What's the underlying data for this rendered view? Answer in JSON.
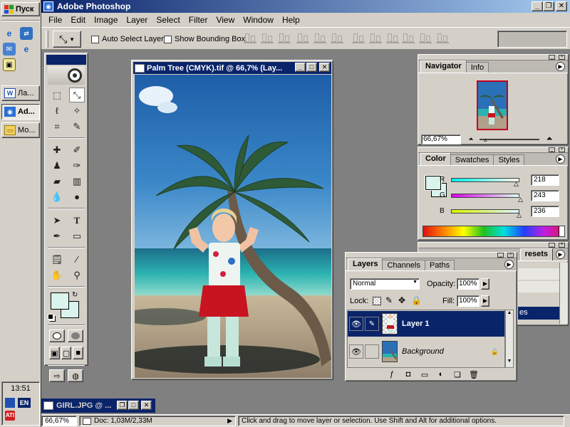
{
  "taskbar": {
    "start_label": "Пуск",
    "clock": "13:51",
    "language": "EN",
    "tasks": [
      {
        "label": "Ла...",
        "icon": "word-icon",
        "active": false
      },
      {
        "label": "Ad...",
        "icon": "photoshop-icon",
        "active": true
      },
      {
        "label": "Мо...",
        "icon": "folder-icon",
        "active": false
      }
    ]
  },
  "app": {
    "title": "Adobe Photoshop",
    "menu": [
      "File",
      "Edit",
      "Image",
      "Layer",
      "Select",
      "Filter",
      "View",
      "Window",
      "Help"
    ]
  },
  "options": {
    "auto_select_label": "Auto Select Layer",
    "bounding_box_label": "Show Bounding Box"
  },
  "document": {
    "title": "Palm Tree (CMYK).tif @ 66,7% (Lay..."
  },
  "navigator": {
    "tabs": [
      "Navigator",
      "Info"
    ],
    "zoom": "66,67%"
  },
  "color": {
    "tabs": [
      "Color",
      "Swatches",
      "Styles"
    ],
    "channels": [
      {
        "label": "R",
        "value": "218"
      },
      {
        "label": "G",
        "value": "243"
      },
      {
        "label": "B",
        "value": "236"
      }
    ],
    "swatch_color": "#daf3ec"
  },
  "presets_behind": {
    "tab_fragment": "resets",
    "row_fragment": "es"
  },
  "layers": {
    "tabs": [
      "Layers",
      "Channels",
      "Paths"
    ],
    "blend_mode": "Normal",
    "opacity_label": "Opacity:",
    "opacity_value": "100%",
    "lock_label": "Lock:",
    "fill_label": "Fill:",
    "fill_value": "100%",
    "items": [
      {
        "name": "Layer 1",
        "selected": true
      },
      {
        "name": "Background",
        "selected": false
      }
    ]
  },
  "minimized_doc": {
    "title": "GIRL.JPG @ ..."
  },
  "status": {
    "zoom": "66,67%",
    "doc_size": "Doc: 1,03M/2,33M",
    "hint": "Click and drag to move layer or selection. Use Shift and Alt for additional options."
  }
}
